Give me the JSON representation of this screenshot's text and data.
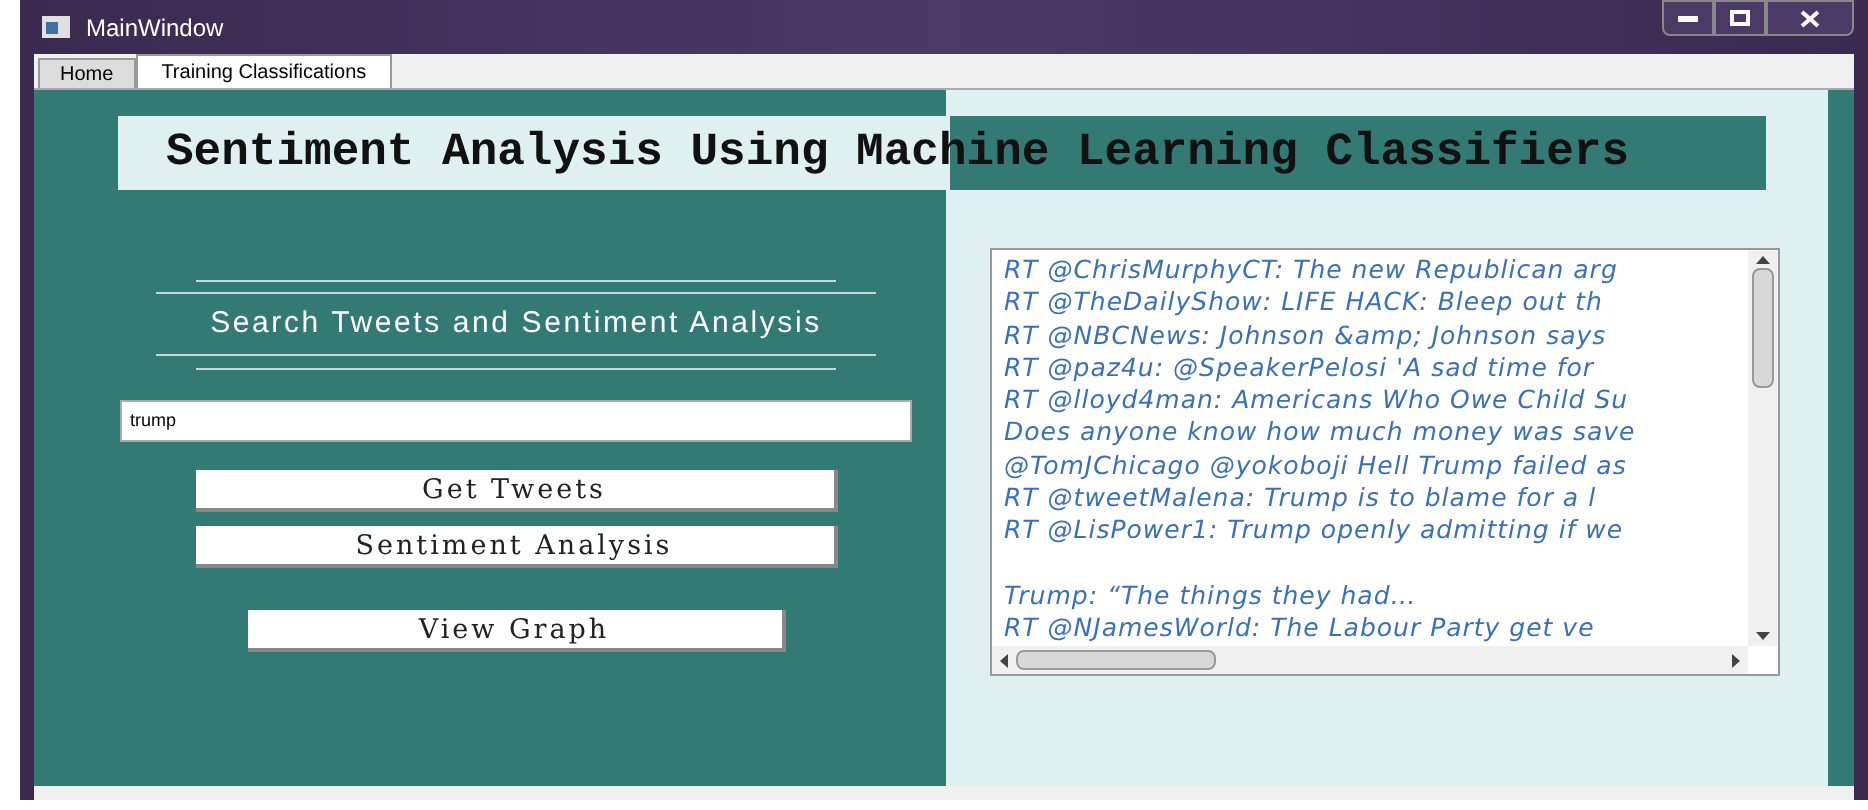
{
  "window": {
    "title": "MainWindow"
  },
  "tabs": [
    {
      "label": "Home",
      "selected": false
    },
    {
      "label": "Training Classifications",
      "selected": true
    }
  ],
  "banner": {
    "title": "Sentiment Analysis Using Machine Learning Classifiers"
  },
  "section": {
    "heading": "Search Tweets and Sentiment Analysis"
  },
  "search": {
    "value": "trump"
  },
  "buttons": [
    "Get Tweets",
    "Sentiment Analysis"
  ],
  "graph_button": "View Graph",
  "tweets": [
    "RT @ChrisMurphyCT: The new Republican arg",
    "RT @TheDailyShow: LIFE HACK: Bleep out th",
    "RT @NBCNews: Johnson &amp; Johnson says",
    "RT @paz4u: @SpeakerPelosi 'A sad time for",
    "RT @lloyd4man: Americans Who Owe Child Su",
    "Does anyone know how much money was save",
    "@TomJChicago @yokoboji Hell Trump failed as",
    "RT @tweetMalena: Trump is to blame for a l",
    "RT @LisPower1: Trump openly admitting if we",
    {
      "text": "Trump: “The things they had…",
      "blank_line_before": true
    },
    "RT @NJamesWorld: The Labour Party get ve"
  ]
}
